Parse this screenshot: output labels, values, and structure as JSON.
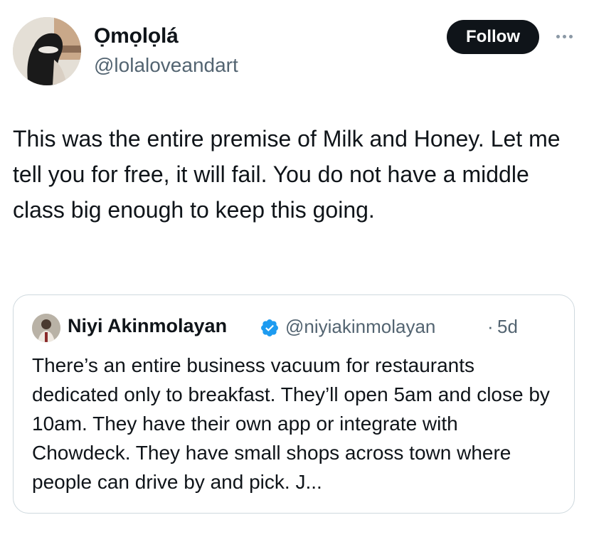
{
  "author": {
    "name": "Ọmọlọlá",
    "handle": "@lolaloveandart"
  },
  "actions": {
    "follow_label": "Follow"
  },
  "tweet": {
    "text": "This was the entire premise of Milk and Honey. Let me tell you for free, it will fail. You do not have a middle class big enough to keep this going."
  },
  "quote": {
    "name": "Niyi Akinmolayan",
    "handle": "@niyiakinmolayan",
    "separator": "·",
    "time": "5d",
    "text": "There’s an entire business vacuum for restaurants dedicated only to breakfast. They’ll open 5am and close by 10am. They have their own app or integrate with Chowdeck. They have small shops across town where people can drive by and pick. J..."
  },
  "icons": {
    "more": "more-horizontal-icon",
    "verified": "verified-badge-icon"
  },
  "colors": {
    "follow_bg": "#0f1419",
    "verified": "#1d9bf0",
    "secondary_text": "#536471",
    "card_border": "#cfd9de"
  }
}
